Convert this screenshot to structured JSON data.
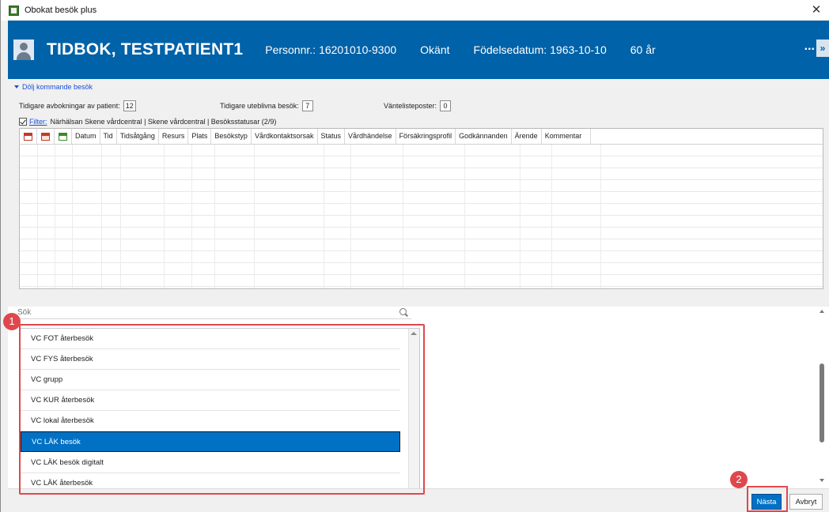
{
  "window": {
    "title": "Obokat besök plus",
    "close_symbol": "✕"
  },
  "patient": {
    "name": "TIDBOK, TESTPATIENT1",
    "personnr_label": "Personnr.:",
    "personnr": "16201010-9300",
    "gender": "Okänt",
    "birthdate_label": "Födelsedatum:",
    "birthdate": "1963-10-10",
    "age": "60 år",
    "more": "...",
    "expand": "»",
    "header_color": "#0062a8"
  },
  "upper": {
    "collapse_link": "Dölj kommande besök",
    "stats": [
      {
        "label": "Tidigare avbokningar av patient:",
        "value": "12"
      },
      {
        "label": "Tidigare uteblivna besök:",
        "value": "7"
      },
      {
        "label": "Väntelisteposter:",
        "value": "0"
      }
    ],
    "filter_link": "Filter:",
    "filter_text": "Närhälsan Skene vårdcentral | Skene vårdcentral | Besöksstatusar (2/9)"
  },
  "grid": {
    "icon_columns": [
      "calendar-red-icon",
      "calendar-red-alt-icon",
      "calendar-green-icon"
    ],
    "columns": [
      "Datum",
      "Tid",
      "Tidsåtgång",
      "Resurs",
      "Plats",
      "Besökstyp",
      "Vårdkontaktsorsak",
      "Status",
      "Vårdhändelse",
      "Försäkringsprofil",
      "Godkännanden",
      "Ärende",
      "Kommentar"
    ]
  },
  "search": {
    "placeholder": "Sök"
  },
  "visit_types": {
    "items": [
      "VC FOT återbesök",
      "VC FYS återbesök",
      "VC grupp",
      "VC KUR återbesök",
      "VC lokal återbesök",
      "VC LÄK besök",
      "VC LÄK besök digitalt",
      "VC LÄK återbesök"
    ],
    "selected": "VC LÄK besök",
    "selected_color": "#0071c5"
  },
  "annotations": {
    "badge1": "1",
    "badge2": "2",
    "color": "#e0474c"
  },
  "footer": {
    "next_label": "Nästa",
    "cancel_label": "Avbryt"
  }
}
